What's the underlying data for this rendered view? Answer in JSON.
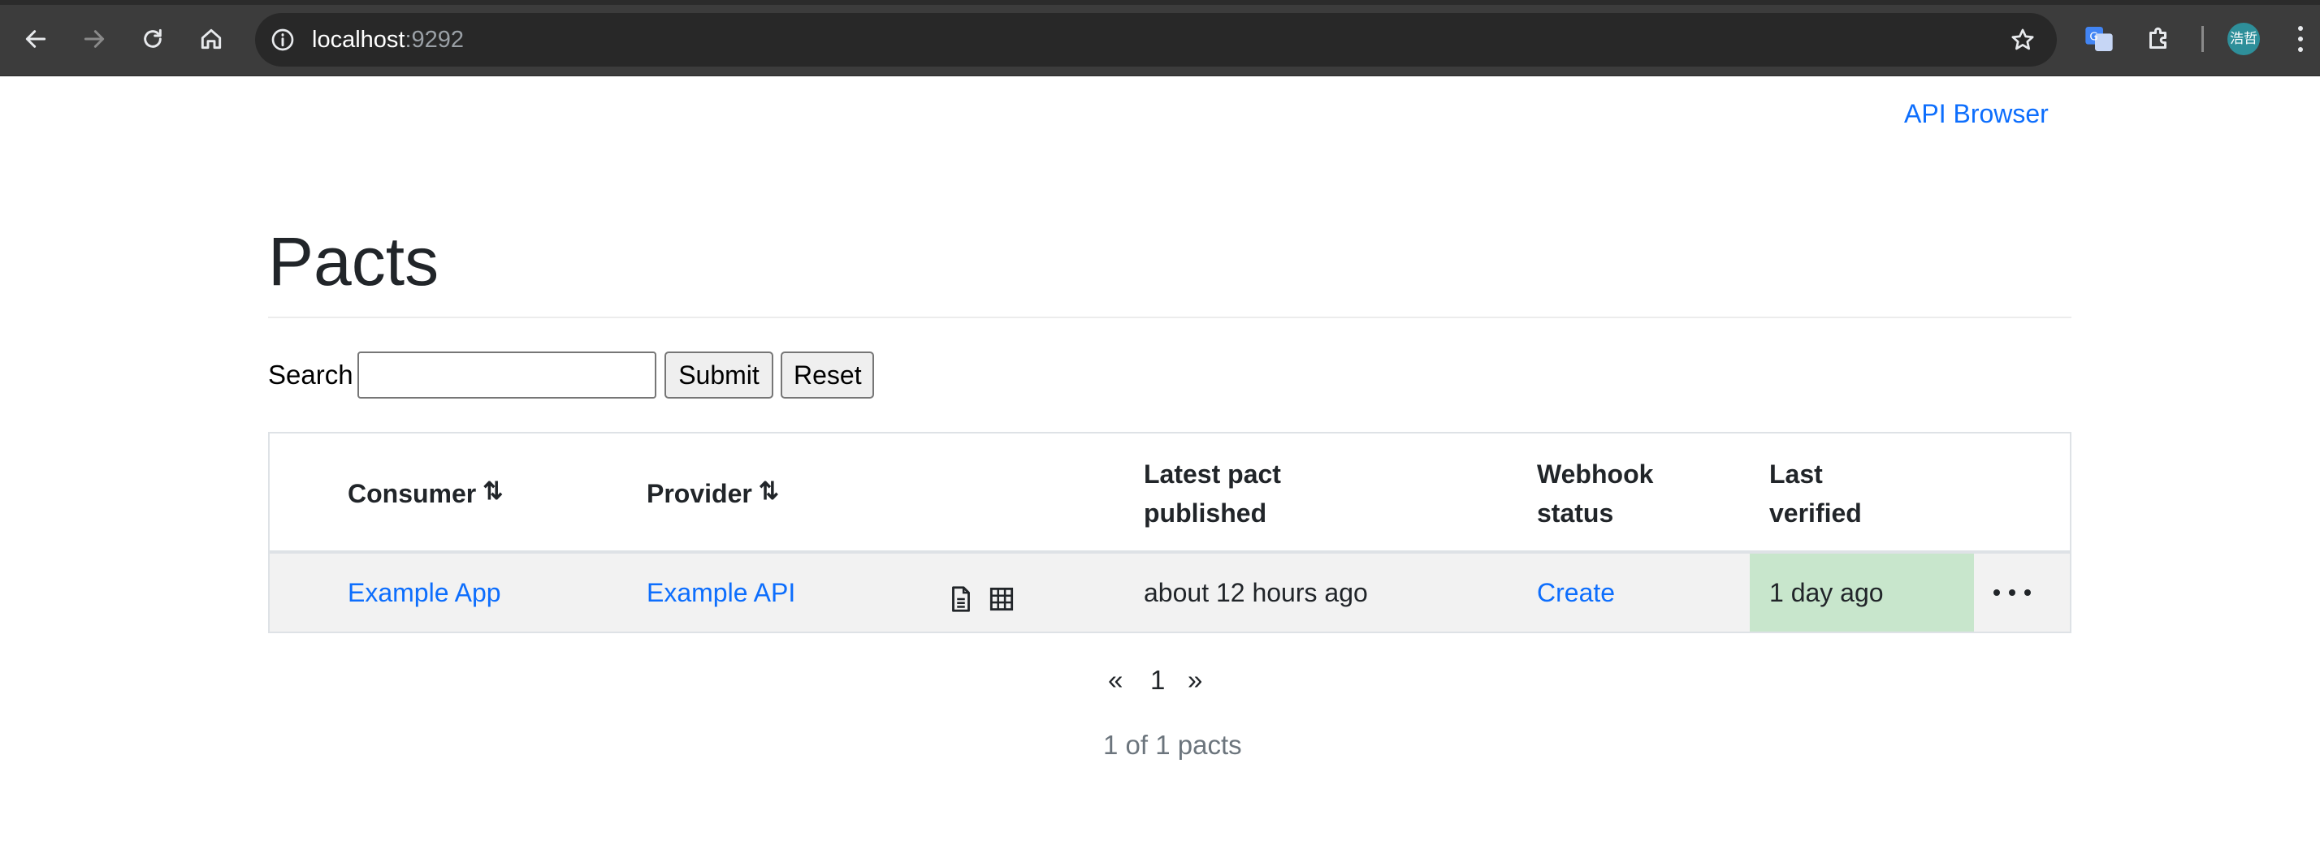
{
  "browser": {
    "url_host": "localhost",
    "url_port": ":9292",
    "profile_label": "浩哲"
  },
  "header": {
    "api_browser_link": "API Browser"
  },
  "page": {
    "title": "Pacts"
  },
  "search": {
    "label": "Search",
    "value": "",
    "placeholder": "",
    "submit_label": "Submit",
    "reset_label": "Reset"
  },
  "table": {
    "headers": {
      "consumer": "Consumer",
      "provider": "Provider",
      "latest_published_line1": "Latest pact",
      "latest_published_line2": "published",
      "webhook_line1": "Webhook",
      "webhook_line2": "status",
      "last_verified_line1": "Last",
      "last_verified_line2": "verified"
    },
    "sort_icon": "⇅",
    "rows": [
      {
        "consumer": "Example App",
        "provider": "Example API",
        "latest_published": "about 12 hours ago",
        "webhook_status": "Create",
        "last_verified": "1 day ago"
      }
    ]
  },
  "pagination": {
    "prev": "«",
    "page": "1",
    "next": "»",
    "summary": "1 of 1 pacts"
  },
  "colors": {
    "link": "#0d6efd",
    "verified_bg": "#c8e6cc",
    "row_bg": "#f2f2f2",
    "chrome_bg": "#3c3c3c"
  },
  "icons": {
    "back": "back-arrow-icon",
    "forward": "forward-arrow-icon",
    "reload": "reload-icon",
    "home": "home-icon",
    "site_info": "info-icon",
    "bookmark": "star-icon",
    "translate": "translate-icon",
    "extensions": "puzzle-icon",
    "pact_doc": "document-icon",
    "matrix": "grid-icon",
    "more": "ellipsis-icon"
  }
}
